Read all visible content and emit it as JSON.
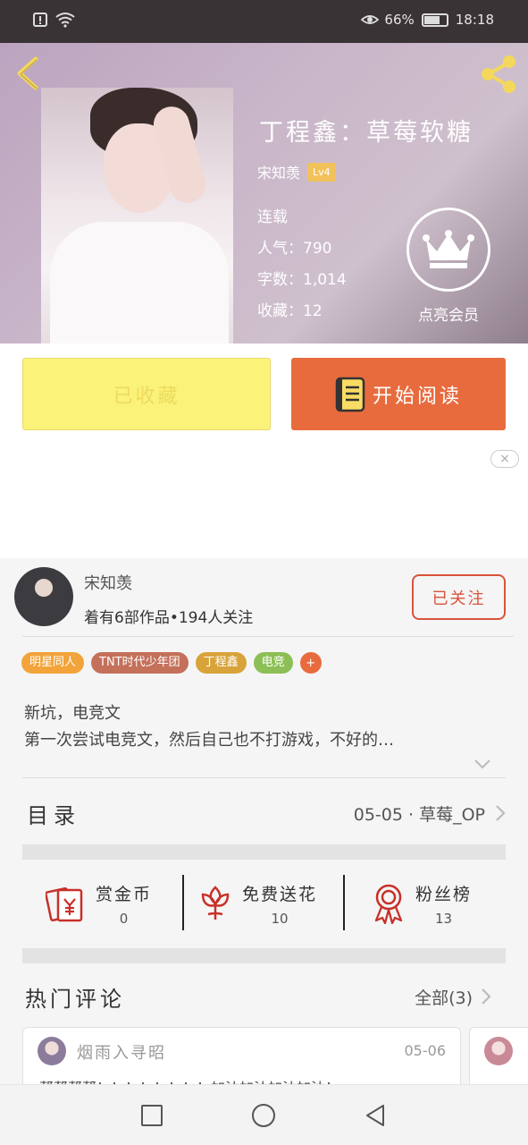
{
  "status_bar": {
    "battery": "66%",
    "time": "18:18",
    "battery_level": 0.66
  },
  "book": {
    "title": "丁程鑫：草莓软糖",
    "author": "宋知羡",
    "level": "Lv4",
    "status": "连载",
    "popularity": "人气：790",
    "words": "字数：1,014",
    "favorites": "收藏：12"
  },
  "vip": {
    "label": "点亮会员"
  },
  "actions": {
    "collected_label": "已收藏",
    "read_label": "开始阅读"
  },
  "ad": {
    "close_label": "×"
  },
  "author_card": {
    "name": "宋知羡",
    "stats": "着有6部作品•194人关注",
    "follow_label": "已关注"
  },
  "tags": [
    {
      "label": "明星同人",
      "color": "#f2a33a"
    },
    {
      "label": "TNT时代少年团",
      "color": "#c4705a"
    },
    {
      "label": "丁程鑫",
      "color": "#d8a33a"
    },
    {
      "label": "电竞",
      "color": "#8cbf55"
    }
  ],
  "tag_add": "+",
  "intro": {
    "line1": "新坑，电竞文",
    "line2": "第一次尝试电竞文，然后自己也不打游戏，不好的…"
  },
  "catalog": {
    "title": "目录",
    "latest": "05-05 · 草莓_OP"
  },
  "stats": [
    {
      "label": "赏金币",
      "value": "0"
    },
    {
      "label": "免费送花",
      "value": "10"
    },
    {
      "label": "粉丝榜",
      "value": "13"
    }
  ],
  "hot_comments": {
    "title": "热门评论",
    "all_label": "全部(3)",
    "items": [
      {
        "user": "烟雨入寻昭",
        "date": "05-06",
        "text": "帮帮帮帮！！！！！！！！加油加油加油加油！"
      }
    ]
  },
  "colors": {
    "accent": "#e86b3e",
    "collected_bg": "#fbf27a",
    "follow": "#d9533b"
  }
}
